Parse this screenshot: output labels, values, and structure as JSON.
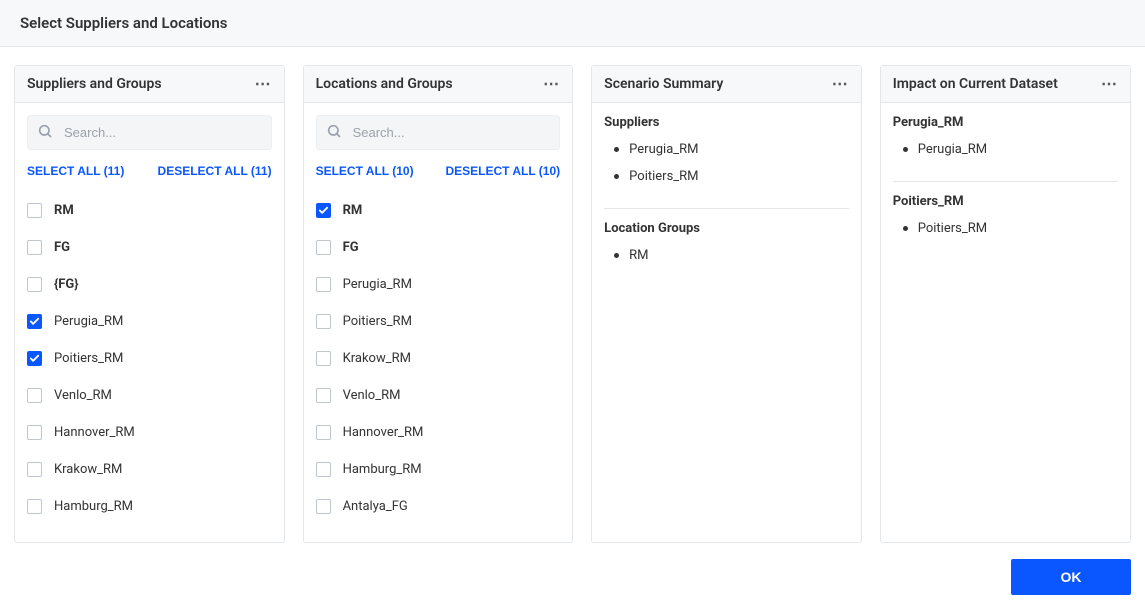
{
  "header": {
    "title": "Select Suppliers and Locations"
  },
  "panels": {
    "suppliers": {
      "title": "Suppliers and Groups",
      "search_placeholder": "Search...",
      "select_all_label": "SELECT ALL (11)",
      "deselect_all_label": "DESELECT ALL (11)",
      "items": [
        {
          "label": "RM",
          "checked": false,
          "bold": true
        },
        {
          "label": "FG",
          "checked": false,
          "bold": true
        },
        {
          "label": "{FG}",
          "checked": false,
          "bold": true
        },
        {
          "label": "Perugia_RM",
          "checked": true,
          "bold": false
        },
        {
          "label": "Poitiers_RM",
          "checked": true,
          "bold": false
        },
        {
          "label": "Venlo_RM",
          "checked": false,
          "bold": false
        },
        {
          "label": "Hannover_RM",
          "checked": false,
          "bold": false
        },
        {
          "label": "Krakow_RM",
          "checked": false,
          "bold": false
        },
        {
          "label": "Hamburg_RM",
          "checked": false,
          "bold": false
        }
      ]
    },
    "locations": {
      "title": "Locations and Groups",
      "search_placeholder": "Search...",
      "select_all_label": "SELECT ALL (10)",
      "deselect_all_label": "DESELECT ALL (10)",
      "items": [
        {
          "label": "RM",
          "checked": true,
          "bold": true
        },
        {
          "label": "FG",
          "checked": false,
          "bold": true
        },
        {
          "label": "Perugia_RM",
          "checked": false,
          "bold": false
        },
        {
          "label": "Poitiers_RM",
          "checked": false,
          "bold": false
        },
        {
          "label": "Krakow_RM",
          "checked": false,
          "bold": false
        },
        {
          "label": "Venlo_RM",
          "checked": false,
          "bold": false
        },
        {
          "label": "Hannover_RM",
          "checked": false,
          "bold": false
        },
        {
          "label": "Hamburg_RM",
          "checked": false,
          "bold": false
        },
        {
          "label": "Antalya_FG",
          "checked": false,
          "bold": false
        }
      ]
    },
    "summary": {
      "title": "Scenario Summary",
      "suppliers_heading": "Suppliers",
      "suppliers": [
        "Perugia_RM",
        "Poitiers_RM"
      ],
      "location_groups_heading": "Location Groups",
      "location_groups": [
        "RM"
      ]
    },
    "impact": {
      "title": "Impact on Current Dataset",
      "groups": [
        {
          "name": "Perugia_RM",
          "items": [
            "Perugia_RM"
          ]
        },
        {
          "name": "Poitiers_RM",
          "items": [
            "Poitiers_RM"
          ]
        }
      ]
    }
  },
  "footer": {
    "ok_label": "OK"
  }
}
